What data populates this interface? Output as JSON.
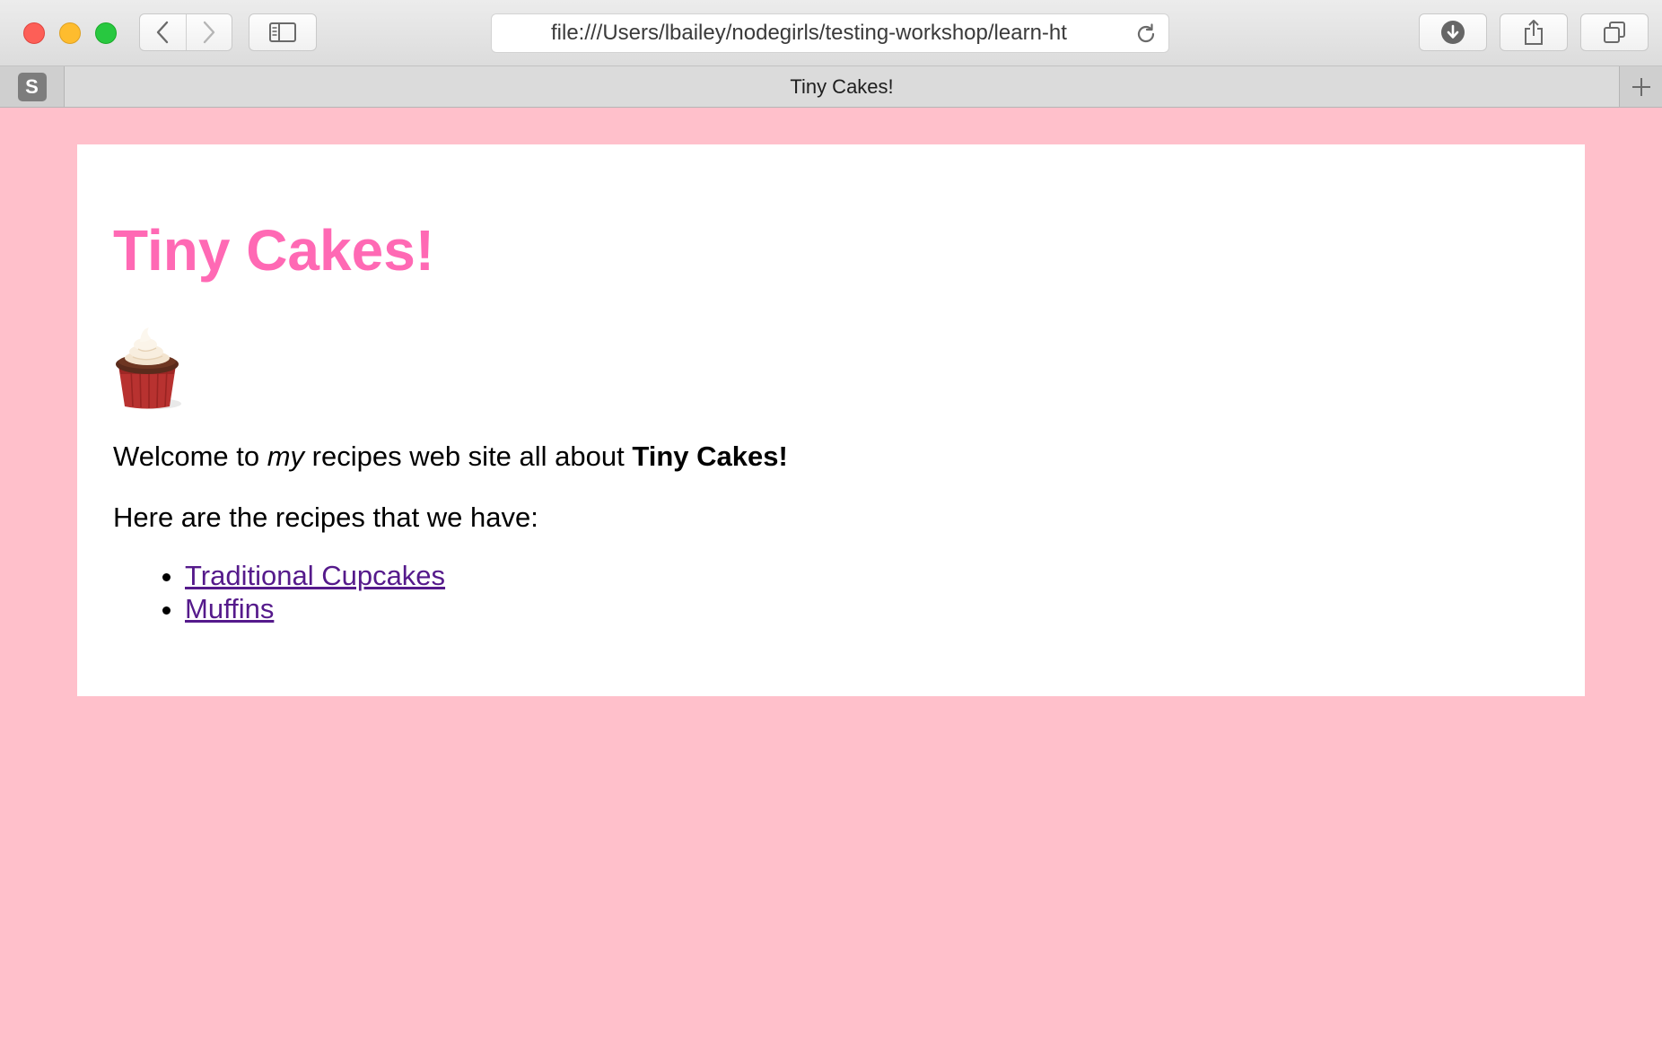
{
  "browser": {
    "url": "file:///Users/lbailey/nodegirls/testing-workshop/learn-ht",
    "tab_title": "Tiny Cakes!",
    "tab_favicon_letter": "S",
    "icons": {
      "back": "chevron-left-icon",
      "forward": "chevron-right-icon",
      "sidebar": "sidebar-icon",
      "reload": "reload-icon",
      "downloads": "download-icon",
      "share": "share-icon",
      "tabs": "tabs-overview-icon",
      "new_tab": "plus-icon"
    }
  },
  "page": {
    "background_color": "#ffc0cb",
    "card_color": "#ffffff",
    "title": "Tiny Cakes!",
    "title_color": "#ff69b4",
    "image": "cupcake-image",
    "intro": {
      "before": "Welcome to ",
      "emphasis": "my",
      "middle": " recipes web site all about ",
      "strong": "Tiny Cakes!"
    },
    "recipes_label": "Here are the recipes that we have:",
    "recipes": [
      {
        "label": "Traditional Cupcakes"
      },
      {
        "label": "Muffins"
      }
    ],
    "link_color": "#551a8b"
  }
}
